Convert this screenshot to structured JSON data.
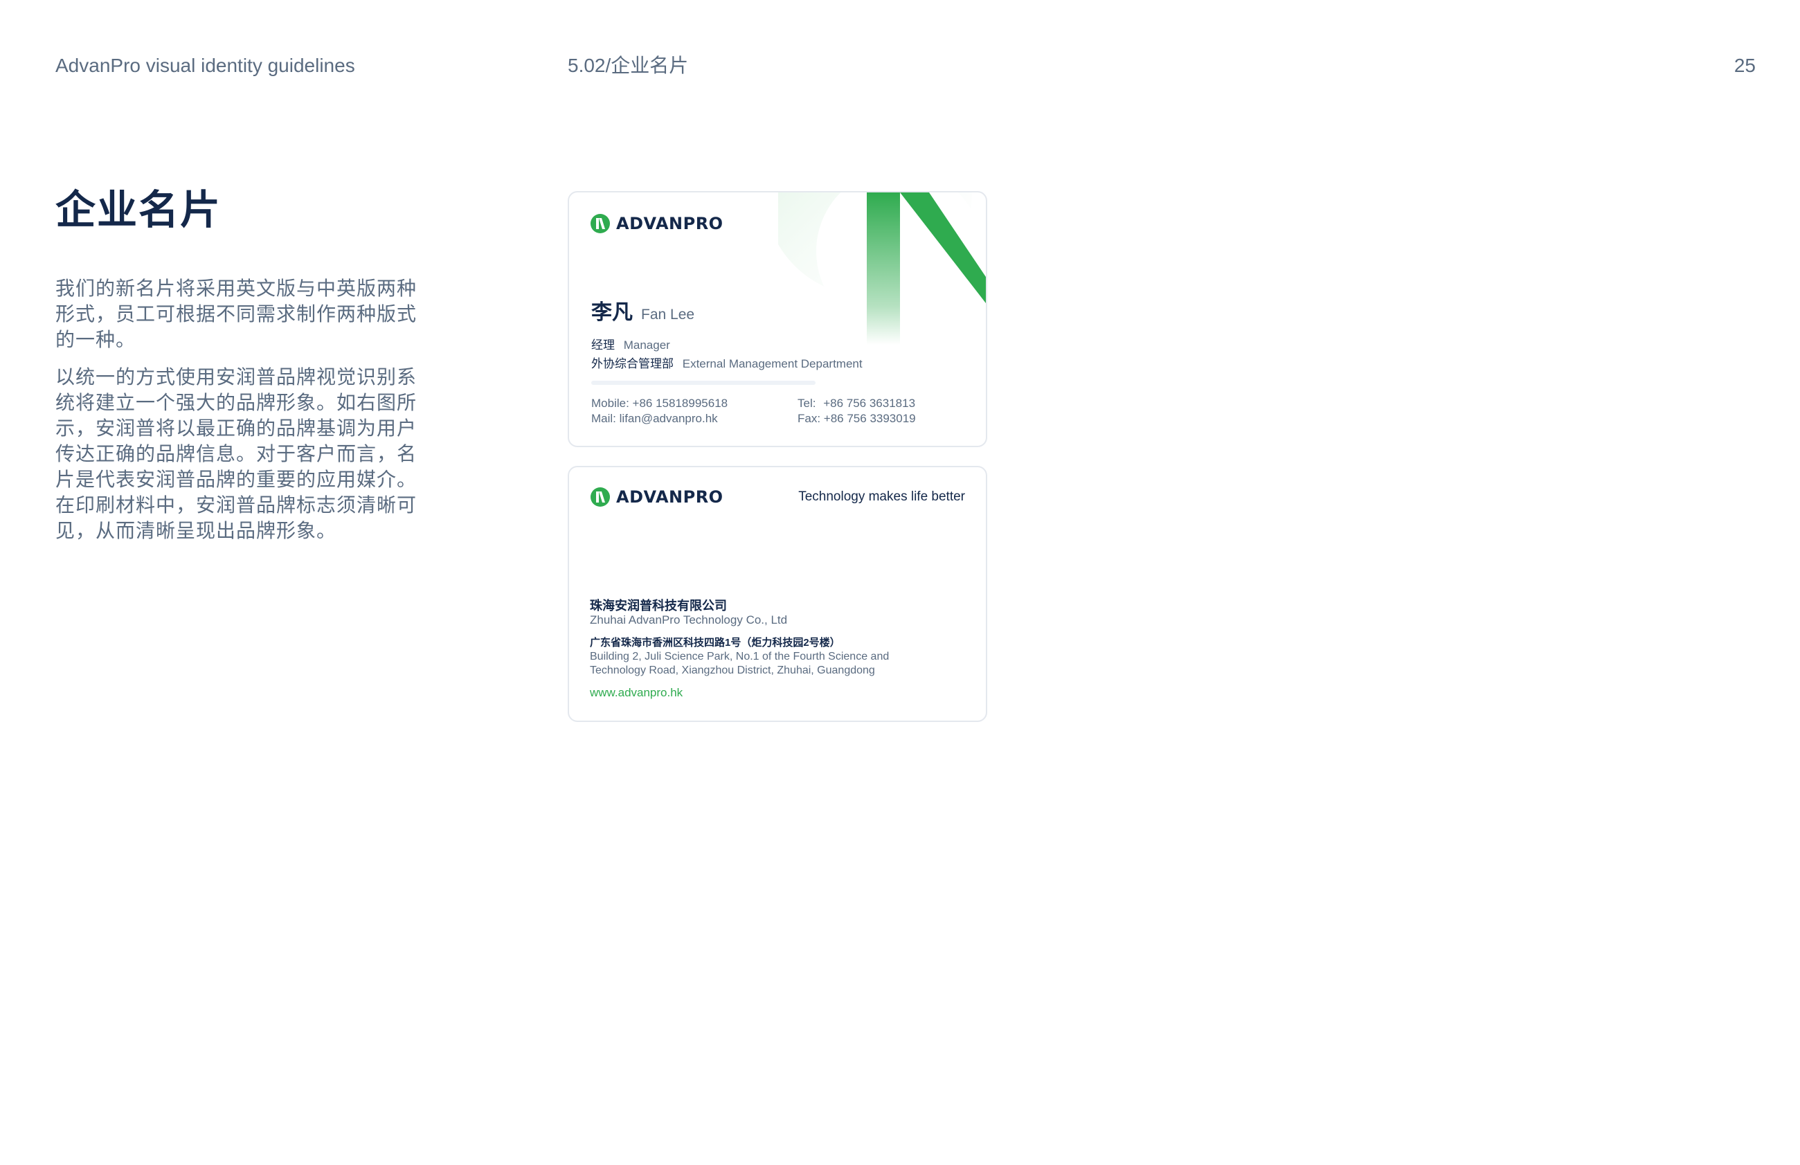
{
  "header": {
    "left": "AdvanPro visual identity guidelines",
    "section": "5.02/企业名片",
    "page_number": "25"
  },
  "main": {
    "title": "企业名片",
    "paragraphs": [
      "我们的新名片将采用英文版与中英版两种形式，员工可根据不同需求制作两种版式的一种。",
      "以统一的方式使用安润普品牌视觉识别系统将建立一个强大的品牌形象。如右图所示，安润普将以最正确的品牌基调为用户传达正确的品牌信息。对于客户而言，名片是代表安润普品牌的重要的应用媒介。在印刷材料中，安润普品牌标志须清晰可见，从而清晰呈现出品牌形象。"
    ]
  },
  "card_front": {
    "logo_text": "ADVANPRO",
    "name_cn": "李凡",
    "name_en": "Fan Lee",
    "title_cn": "经理",
    "title_en": "Manager",
    "dept_cn": "外协综合管理部",
    "dept_en": "External Management Department",
    "mobile_label": "Mobile:",
    "mobile": "+86 15818995618",
    "mail_label": "Mail:",
    "mail": "lifan@advanpro.hk",
    "tel_label": "Tel:",
    "tel": "+86 756 3631813",
    "fax_label": "Fax:",
    "fax": "+86 756 3393019"
  },
  "card_back": {
    "logo_text": "ADVANPRO",
    "slogan": "Technology makes life better",
    "company_cn": "珠海安润普科技有限公司",
    "company_en": "Zhuhai AdvanPro Technology Co., Ltd",
    "address_cn": "广东省珠海市香洲区科技四路1号（炬力科技园2号楼）",
    "address_en_1": "Building 2, Juli Science Park, No.1 of the Fourth Science and",
    "address_en_2": "Technology Road, Xiangzhou District, Zhuhai, Guangdong",
    "website": "www.advanpro.hk"
  },
  "colors": {
    "brand_green": "#2fab4f",
    "navy": "#14284a",
    "text_gray": "#5a6b80",
    "card_border": "#e4e8ee"
  },
  "icons": [
    "advanpro-logo-mark-icon",
    "brand-triangle-graphic"
  ]
}
